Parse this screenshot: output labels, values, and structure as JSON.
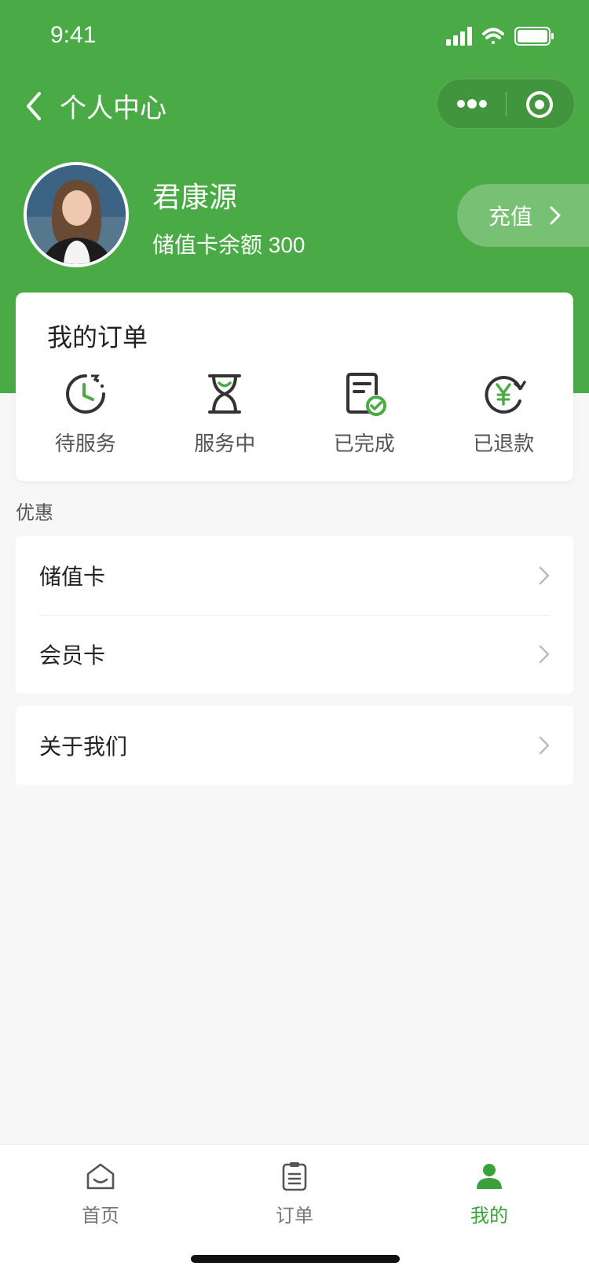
{
  "status_bar": {
    "time": "9:41"
  },
  "nav": {
    "title": "个人中心"
  },
  "profile": {
    "name": "君康源",
    "balance_text": "储值卡余额 300"
  },
  "recharge": {
    "label": "充值"
  },
  "orders": {
    "title": "我的订单",
    "items": [
      {
        "label": "待服务",
        "icon": "clock-icon"
      },
      {
        "label": "服务中",
        "icon": "hourglass-icon"
      },
      {
        "label": "已完成",
        "icon": "doc-check-icon"
      },
      {
        "label": "已退款",
        "icon": "yen-refresh-icon"
      }
    ]
  },
  "discounts": {
    "section_title": "优惠",
    "items": [
      {
        "label": "储值卡"
      },
      {
        "label": "会员卡"
      }
    ]
  },
  "about": {
    "label": "关于我们"
  },
  "tabs": [
    {
      "label": "首页",
      "icon": "home-icon",
      "active": false
    },
    {
      "label": "订单",
      "icon": "clipboard-icon",
      "active": false
    },
    {
      "label": "我的",
      "icon": "user-icon",
      "active": true
    }
  ],
  "colors": {
    "brand_green": "#4aab46",
    "active_tab": "#3aa13a",
    "background": "#f7f7f7"
  }
}
